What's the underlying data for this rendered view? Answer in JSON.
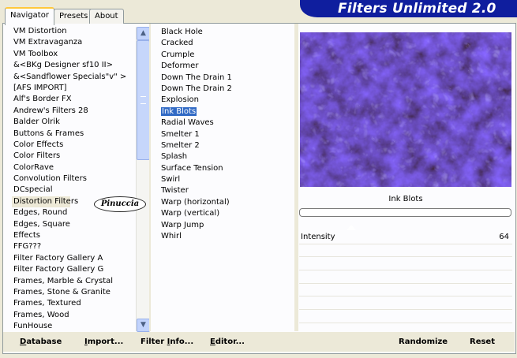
{
  "app": {
    "title": "Filters Unlimited 2.0"
  },
  "tabs": [
    {
      "label": "Navigator"
    },
    {
      "label": "Presets"
    },
    {
      "label": "About"
    }
  ],
  "categories": {
    "items": [
      "VM Distortion",
      "VM Extravaganza",
      "VM Toolbox",
      "&<BKg Designer sf10 II>",
      "&<Sandflower Specials\"v\" >",
      "[AFS IMPORT]",
      "Alf's Border FX",
      "Andrew's Filters 28",
      "Balder Olrik",
      "Buttons & Frames",
      "Color Effects",
      "Color Filters",
      "ColorRave",
      "Convolution Filters",
      "DCspecial",
      "Distortion Filters",
      "Edges, Round",
      "Edges, Square",
      "Effects",
      "FFG???",
      "Filter Factory Gallery A",
      "Filter Factory Gallery G",
      "Frames, Marble & Crystal",
      "Frames, Stone & Granite",
      "Frames, Textured",
      "Frames, Wood",
      "FunHouse"
    ],
    "selected": "Distortion Filters"
  },
  "filters": {
    "items": [
      "Black Hole",
      "Cracked",
      "Crumple",
      "Deformer",
      "Down The Drain 1",
      "Down The Drain 2",
      "Explosion",
      "Ink Blots",
      "Radial Waves",
      "Smelter 1",
      "Smelter 2",
      "Splash",
      "Surface Tension",
      "Swirl",
      "Twister",
      "Warp (horizontal)",
      "Warp (vertical)",
      "Warp Jump",
      "Whirl"
    ],
    "selected": "Ink Blots"
  },
  "preview": {
    "label": "Ink Blots"
  },
  "params": {
    "intensity_label": "Intensity",
    "intensity_value": "64"
  },
  "buttons": {
    "database": {
      "u": "D",
      "rest": "atabase"
    },
    "import": {
      "u": "I",
      "rest": "mport..."
    },
    "filter_info_pre": "Filter ",
    "filter_info": {
      "u": "I",
      "rest": "nfo..."
    },
    "editor": {
      "u": "E",
      "rest": "ditor..."
    },
    "randomize": "Randomize",
    "reset": "Reset"
  },
  "watermark": "Pinuccia",
  "colors": {
    "accent": "#316ac5",
    "banner": "#0f1e9e",
    "preview_bg": "#1a157a"
  }
}
